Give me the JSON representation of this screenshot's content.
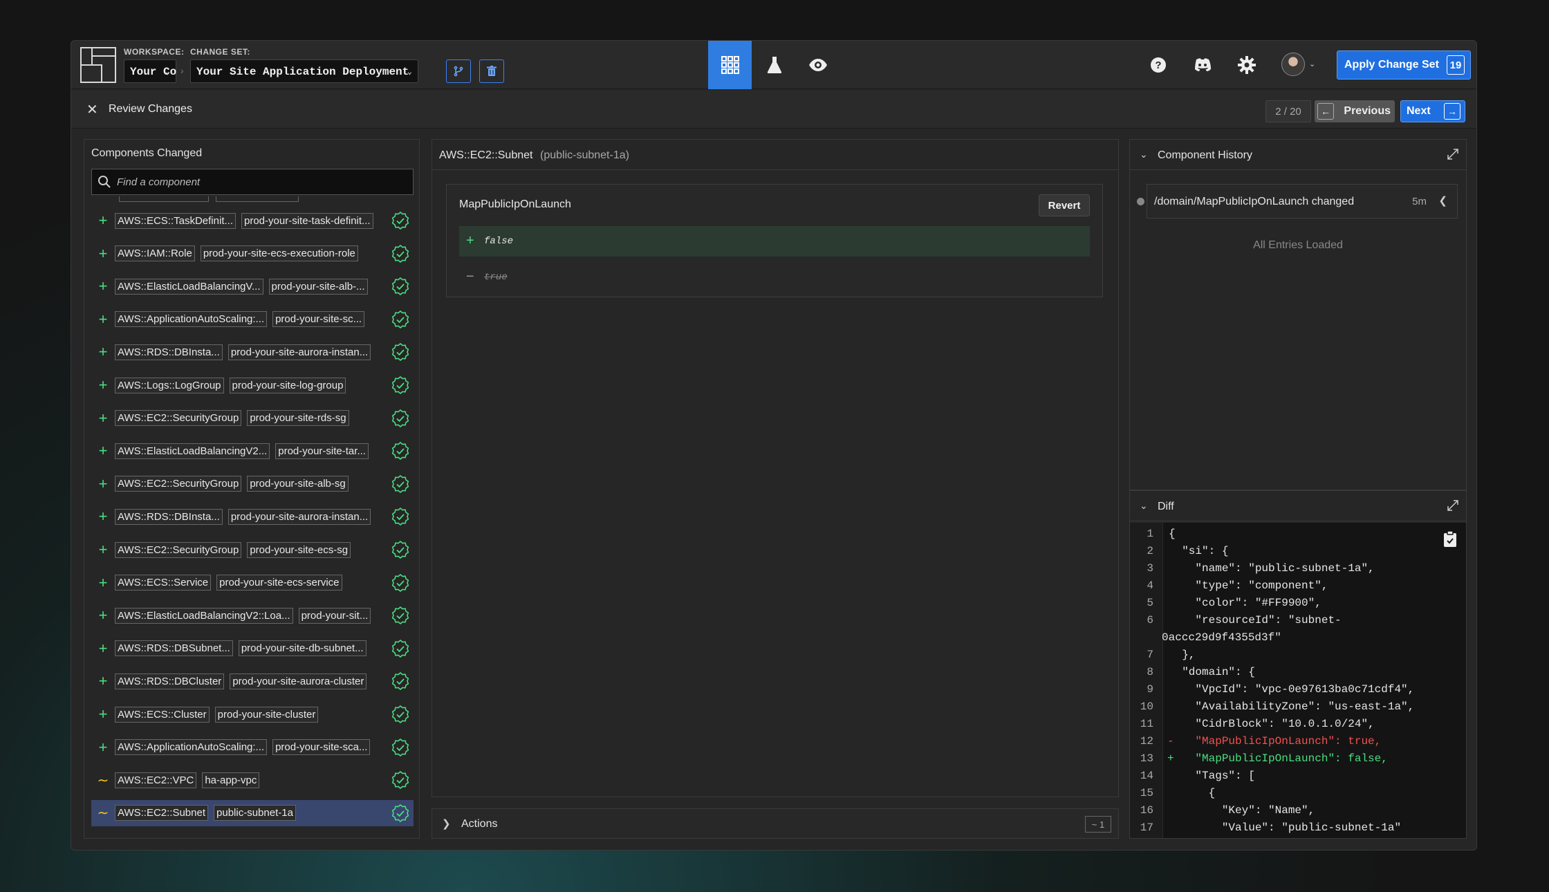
{
  "header": {
    "workspace_label": "WORKSPACE:",
    "workspace_value": "Your Co",
    "changeset_label": "CHANGE SET:",
    "changeset_value": "Your Site Application Deployment",
    "apply_label": "Apply Change Set",
    "apply_count": "19",
    "icons": [
      "grid-icon",
      "beaker-icon",
      "eye-icon",
      "help-icon",
      "discord-icon",
      "gear-icon"
    ]
  },
  "subbar": {
    "title": "Review Changes",
    "pager": "2 / 20",
    "previous": "Previous",
    "next": "Next"
  },
  "components_panel": {
    "title": "Components Changed",
    "search_placeholder": "Find a component",
    "items": [
      {
        "type": "AWS::ECS::TaskDefinit...",
        "name": "prod-your-site-task-definit...",
        "change": "add"
      },
      {
        "type": "AWS::IAM::Role",
        "name": "prod-your-site-ecs-execution-role",
        "change": "add"
      },
      {
        "type": "AWS::ElasticLoadBalancingV...",
        "name": "prod-your-site-alb-...",
        "change": "add"
      },
      {
        "type": "AWS::ApplicationAutoScaling:...",
        "name": "prod-your-site-sc...",
        "change": "add"
      },
      {
        "type": "AWS::RDS::DBInsta...",
        "name": "prod-your-site-aurora-instan...",
        "change": "add"
      },
      {
        "type": "AWS::Logs::LogGroup",
        "name": "prod-your-site-log-group",
        "change": "add"
      },
      {
        "type": "AWS::EC2::SecurityGroup",
        "name": "prod-your-site-rds-sg",
        "change": "add"
      },
      {
        "type": "AWS::ElasticLoadBalancingV2...",
        "name": "prod-your-site-tar...",
        "change": "add"
      },
      {
        "type": "AWS::EC2::SecurityGroup",
        "name": "prod-your-site-alb-sg",
        "change": "add"
      },
      {
        "type": "AWS::RDS::DBInsta...",
        "name": "prod-your-site-aurora-instan...",
        "change": "add"
      },
      {
        "type": "AWS::EC2::SecurityGroup",
        "name": "prod-your-site-ecs-sg",
        "change": "add"
      },
      {
        "type": "AWS::ECS::Service",
        "name": "prod-your-site-ecs-service",
        "change": "add"
      },
      {
        "type": "AWS::ElasticLoadBalancingV2::Loa...",
        "name": "prod-your-sit...",
        "change": "add"
      },
      {
        "type": "AWS::RDS::DBSubnet...",
        "name": "prod-your-site-db-subnet...",
        "change": "add"
      },
      {
        "type": "AWS::RDS::DBCluster",
        "name": "prod-your-site-aurora-cluster",
        "change": "add"
      },
      {
        "type": "AWS::ECS::Cluster",
        "name": "prod-your-site-cluster",
        "change": "add"
      },
      {
        "type": "AWS::ApplicationAutoScaling:...",
        "name": "prod-your-site-sca...",
        "change": "add"
      },
      {
        "type": "AWS::EC2::VPC",
        "name": "ha-app-vpc",
        "change": "modify"
      },
      {
        "type": "AWS::EC2::Subnet",
        "name": "public-subnet-1a",
        "change": "modify",
        "selected": true
      }
    ],
    "colors": {
      "add": "#4ade80",
      "modify": "#facc15",
      "selected_bg": "#39466e"
    }
  },
  "center": {
    "component_type": "AWS::EC2::Subnet",
    "component_name": "(public-subnet-1a)",
    "property": "MapPublicIpOnLaunch",
    "revert_label": "Revert",
    "new_value": "false",
    "old_value": "true",
    "actions_label": "Actions",
    "actions_count": "~ 1"
  },
  "history": {
    "title": "Component History",
    "entry_text": "/domain/MapPublicIpOnLaunch changed",
    "entry_time": "5m",
    "footer": "All Entries Loaded"
  },
  "diff": {
    "title": "Diff",
    "lines": [
      {
        "n": "1",
        "text": "{",
        "kind": ""
      },
      {
        "n": "2",
        "text": "  \"si\": {",
        "kind": ""
      },
      {
        "n": "3",
        "text": "    \"name\": \"public-subnet-1a\",",
        "kind": ""
      },
      {
        "n": "4",
        "text": "    \"type\": \"component\",",
        "kind": ""
      },
      {
        "n": "5",
        "text": "    \"color\": \"#FF9900\",",
        "kind": ""
      },
      {
        "n": "6",
        "text": "    \"resourceId\": \"subnet-",
        "kind": ""
      },
      {
        "n": "",
        "text": "0accc29d9f4355d3f\"",
        "kind": "wrap"
      },
      {
        "n": "7",
        "text": "  },",
        "kind": ""
      },
      {
        "n": "8",
        "text": "  \"domain\": {",
        "kind": ""
      },
      {
        "n": "9",
        "text": "    \"VpcId\": \"vpc-0e97613ba0c71cdf4\",",
        "kind": ""
      },
      {
        "n": "10",
        "text": "    \"AvailabilityZone\": \"us-east-1a\",",
        "kind": ""
      },
      {
        "n": "11",
        "text": "    \"CidrBlock\": \"10.0.1.0/24\",",
        "kind": ""
      },
      {
        "n": "12",
        "text": "    \"MapPublicIpOnLaunch\": true,",
        "kind": "del"
      },
      {
        "n": "13",
        "text": "    \"MapPublicIpOnLaunch\": false,",
        "kind": "add"
      },
      {
        "n": "14",
        "text": "    \"Tags\": [",
        "kind": ""
      },
      {
        "n": "15",
        "text": "      {",
        "kind": ""
      },
      {
        "n": "16",
        "text": "        \"Key\": \"Name\",",
        "kind": ""
      },
      {
        "n": "17",
        "text": "        \"Value\": \"public-subnet-1a\"",
        "kind": ""
      }
    ]
  }
}
